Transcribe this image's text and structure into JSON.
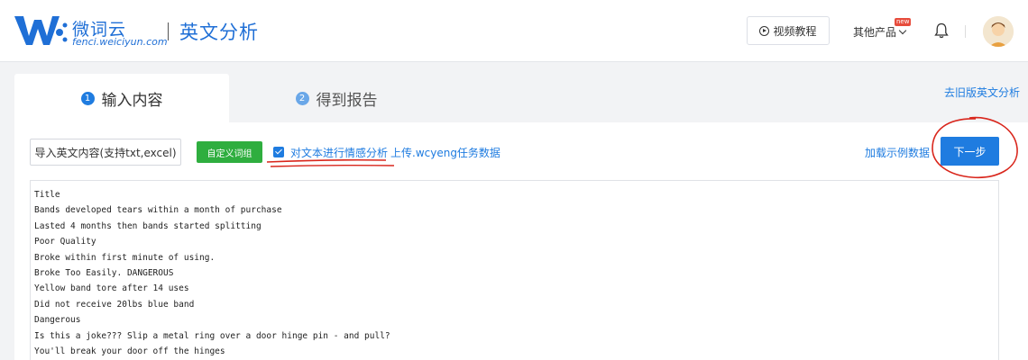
{
  "header": {
    "logo_name": "微词云",
    "logo_domain": "fenci.weiciyun.com",
    "page_title": "英文分析",
    "video_tutorial": "视频教程",
    "other_products": "其他产品",
    "new_badge": "new"
  },
  "tabs": [
    {
      "num": "1",
      "label": "输入内容"
    },
    {
      "num": "2",
      "label": "得到报告"
    }
  ],
  "old_version_link": "去旧版英文分析",
  "toolbar": {
    "import_label": "导入英文内容(支持txt,excel)",
    "custom_dict_label": "自定义词组",
    "sentiment_label": "对文本进行情感分析",
    "sentiment_checked": true,
    "upload_label": "上传.wcyeng任务数据",
    "example_label": "加载示例数据",
    "next_label": "下一步"
  },
  "text_lines": [
    "Title",
    "Bands developed tears within a month of purchase",
    "Lasted 4 months then bands started splitting",
    "Poor Quality",
    "Broke within first minute of using.",
    "Broke Too Easily. DANGEROUS",
    "Yellow band tore after 14 uses",
    "Did not receive 20lbs blue band",
    "Dangerous",
    "Is this a joke??? Slip a metal ring over a door hinge pin - and pull?",
    "You'll break your door off the hinges"
  ],
  "colors": {
    "brand_blue": "#1f6fd6",
    "link_blue": "#1f7ce0",
    "green": "#2fae3f",
    "annotation_red": "#d9261c"
  }
}
